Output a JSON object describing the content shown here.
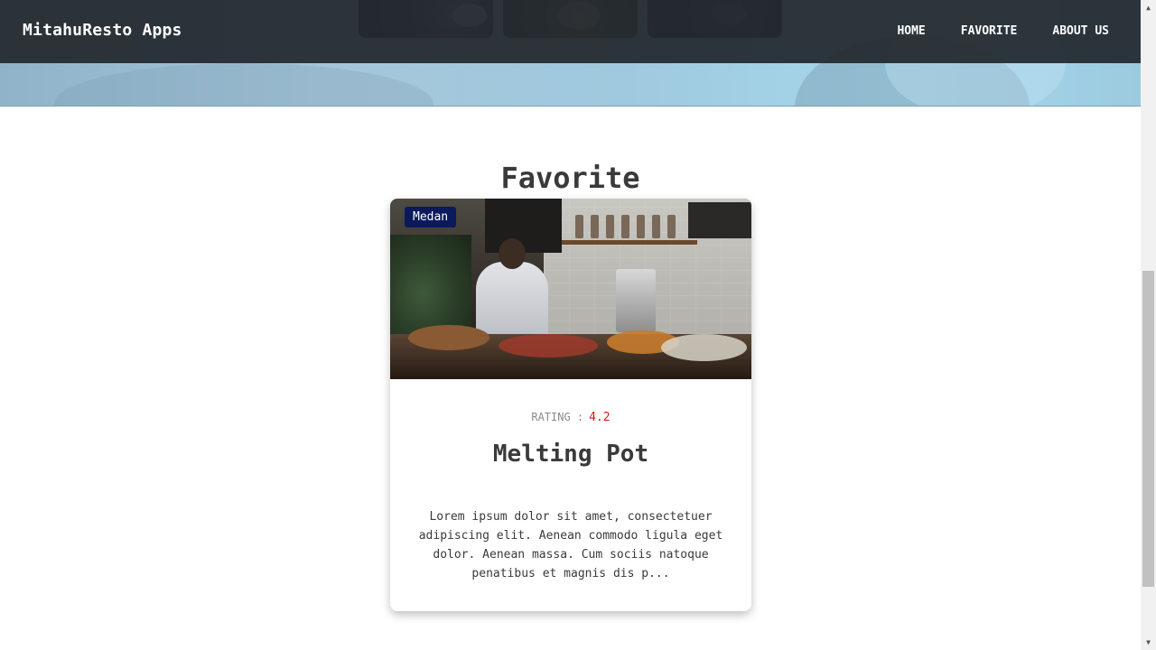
{
  "navbar": {
    "brand": "MitahuResto Apps",
    "links": [
      "HOME",
      "FAVORITE",
      "ABOUT US"
    ]
  },
  "section": {
    "title": "Favorite"
  },
  "restaurants": [
    {
      "city": "Medan",
      "rating_label": "RATING :",
      "rating": "4.2",
      "name": "Melting Pot",
      "description": "Lorem ipsum dolor sit amet, consectetuer adipiscing elit. Aenean commodo ligula eget dolor. Aenean massa. Cum sociis natoque penatibus et magnis dis p..."
    }
  ],
  "colors": {
    "navbar_bg": "#242a30",
    "city_badge_bg": "#0b1a5c",
    "rating_value": "#d11a1a",
    "title_text": "#3a3a3a"
  },
  "icons": {
    "scroll_up": "triangle-up-icon",
    "scroll_down": "triangle-down-icon"
  }
}
